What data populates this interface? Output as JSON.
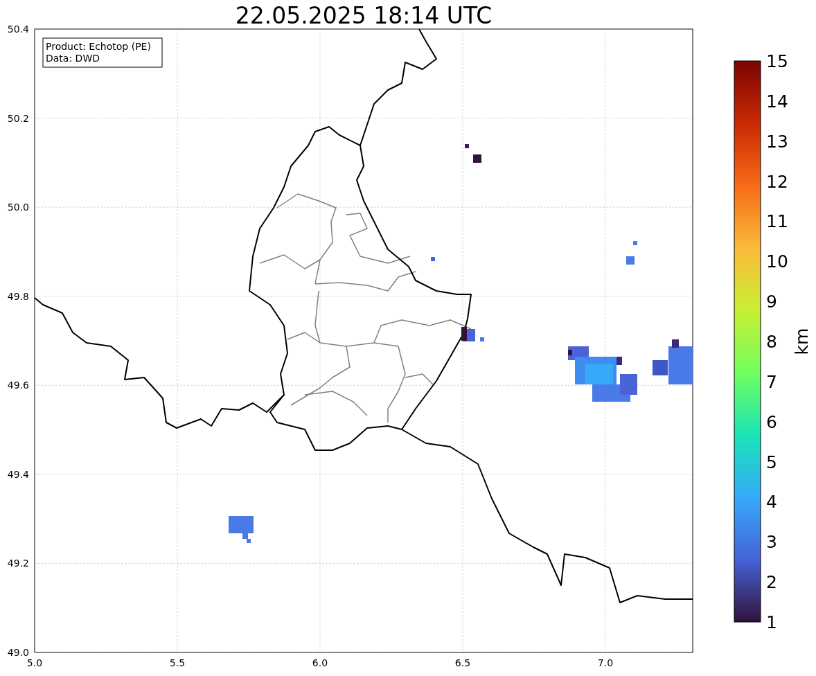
{
  "title": "22.05.2025 18:14 UTC",
  "legend": [
    "Product: Echotop (PE)",
    "Data: DWD"
  ],
  "map": {
    "xticks": [
      "5.0",
      "5.5",
      "6.0",
      "6.5",
      "7.0"
    ],
    "yticks": [
      "50.4",
      "50.2",
      "50.0",
      "49.8",
      "49.6",
      "49.4",
      "49.2",
      "49.0"
    ]
  },
  "colorbar": {
    "label": "km",
    "ticks": [
      "15",
      "14",
      "13",
      "12",
      "11",
      "10",
      "9",
      "8",
      "7",
      "6",
      "5",
      "4",
      "3",
      "2",
      "1"
    ]
  }
}
